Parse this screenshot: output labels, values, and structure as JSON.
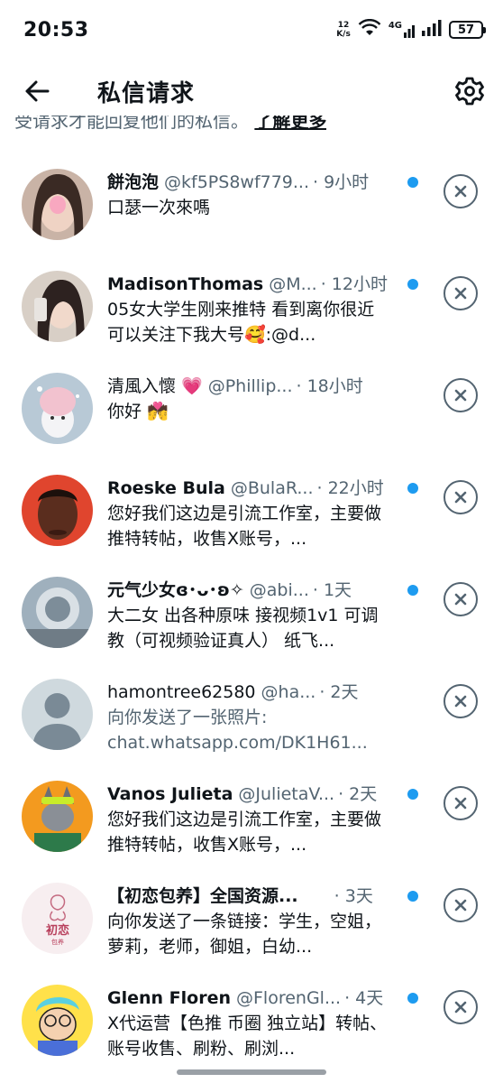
{
  "status_bar": {
    "time": "20:53",
    "net_speed_top": "12",
    "net_speed_bottom": "K/s",
    "network_type": "4G",
    "battery": "57"
  },
  "header": {
    "title": "私信请求",
    "back_icon": "arrow-left-icon",
    "settings_icon": "gear-icon"
  },
  "notice": {
    "text": "受请求才能回复他们的私信。",
    "link": "了解更多"
  },
  "colors": {
    "unread_dot": "#1d9bf0",
    "secondary_text": "#536471"
  },
  "requests": [
    {
      "name": "餅泡泡",
      "handle": "@kf5PS8wf779...",
      "time": "· 9小时",
      "unread": true,
      "preview": "口瑟一次來嗎"
    },
    {
      "name": "MadisonThomas",
      "handle": "@M...",
      "time": "· 12小时",
      "unread": true,
      "preview": "05女大学生刚来推特 看到离你很近 可以关注下我大号🥰:@d..."
    },
    {
      "name": "清風入懷 💗",
      "handle": "@Phillip...",
      "time": "· 18小时",
      "unread": false,
      "preview": "你好 💏"
    },
    {
      "name": "Roeske Bula",
      "handle": "@BulaR...",
      "time": "· 22小时",
      "unread": true,
      "preview": "您好我们这边是引流工作室，主要做推特转帖，收售X账号，..."
    },
    {
      "name": "元气少女ɞ･ᴗ･ʚ✧",
      "handle": "@abi...",
      "time": "· 1天",
      "unread": true,
      "preview": "大二女 出各种原味 接视频1v1 可调教（可视频验证真人） 纸飞..."
    },
    {
      "name": "hamontree62580",
      "handle": "@ha...",
      "time": "· 2天",
      "unread": false,
      "preview": "向你发送了一张照片: chat.whatsapp.com/DK1H61..."
    },
    {
      "name": "Vanos Julieta",
      "handle": "@JulietaV...",
      "time": "· 2天",
      "unread": true,
      "preview": "您好我们这边是引流工作室，主要做推特转帖，收售X账号，..."
    },
    {
      "name": "【初恋包养】全国资源...",
      "handle": "",
      "time": "· 3天",
      "unread": true,
      "preview": "向你发送了一条链接：学生，空姐，萝莉，老师，御姐，白幼..."
    },
    {
      "name": "Glenn Floren",
      "handle": "@FlorenGl...",
      "time": "· 4天",
      "unread": true,
      "preview": "X代运营【色推 币圈 独立站】转帖、账号收售、刷粉、刷浏..."
    }
  ],
  "avatar_logo_text": {
    "top": "初恋",
    "bottom": "包养"
  }
}
